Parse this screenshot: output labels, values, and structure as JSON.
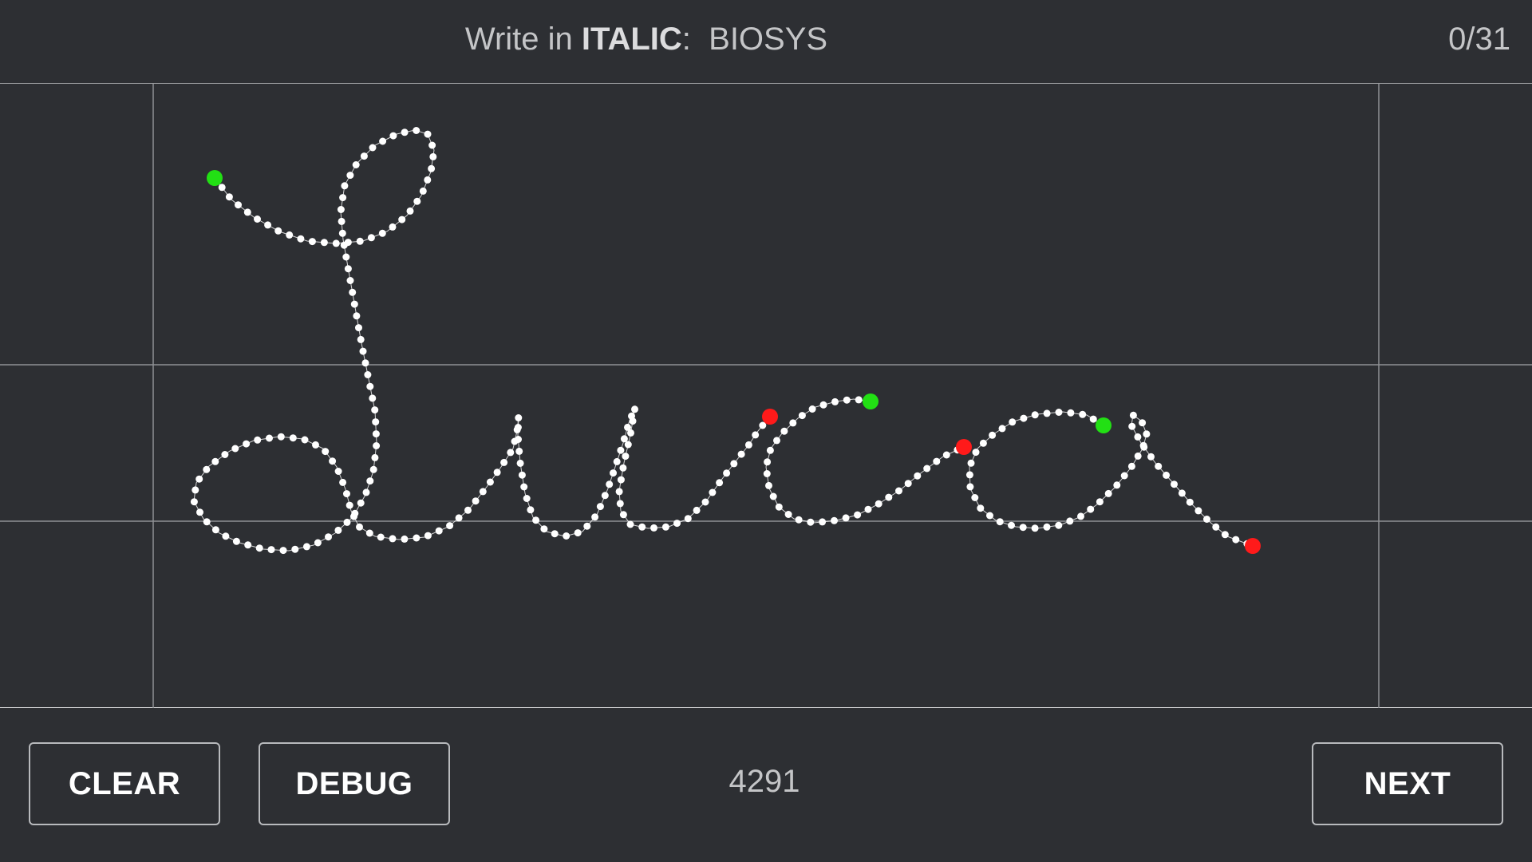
{
  "header": {
    "prompt_prefix": "Write in ",
    "style_word": "ITALIC",
    "prompt_colon": ":",
    "target_word": "BIOSYS",
    "progress": "0/31"
  },
  "footer": {
    "clear_label": "CLEAR",
    "debug_label": "DEBUG",
    "counter": "4291",
    "next_label": "NEXT"
  },
  "colors": {
    "background": "#2d2f33",
    "stroke_point": "#ffffff",
    "stroke_start": "#22e014",
    "stroke_end": "#ff1a1a",
    "guide_line": "#8e9094"
  },
  "handwriting": {
    "written_text": "Luca",
    "stroke_count": 3
  }
}
